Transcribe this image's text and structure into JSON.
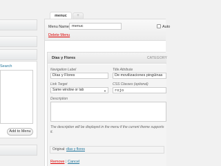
{
  "left_panel": {
    "search_link": "Search",
    "add_to_menu": "Add to Menu"
  },
  "tabs": [
    {
      "label": "menuc"
    },
    {
      "label": "+"
    }
  ],
  "menu_header": {
    "name_label": "Menu Name",
    "name_value": "menuc",
    "auto_add_label": "Auto",
    "delete_menu": "Delete Menu"
  },
  "menu_item": {
    "title": "Días y Flores",
    "type": "CATEGORY",
    "navigation_label": {
      "label": "Navigation Label",
      "value": "Días y Flores"
    },
    "title_attribute": {
      "label": "Title Attribute",
      "value": "De movilizaciones pingüinas"
    },
    "link_target": {
      "label": "Link Target",
      "value": "Same window or tab"
    },
    "css_classes": {
      "label": "CSS Classes (optional)",
      "value": "rojo"
    },
    "description": {
      "label": "Description",
      "value": ""
    },
    "description_note": "The description will be displayed in the menu if the current theme supports it.",
    "original_label": "Original:",
    "original_link": "días y flores",
    "remove": "Remove",
    "separator": "|",
    "cancel": "Cancel"
  },
  "colors": {
    "link": "#21759b",
    "delete": "#dd0000",
    "panel_bg": "#f4f4f4"
  }
}
